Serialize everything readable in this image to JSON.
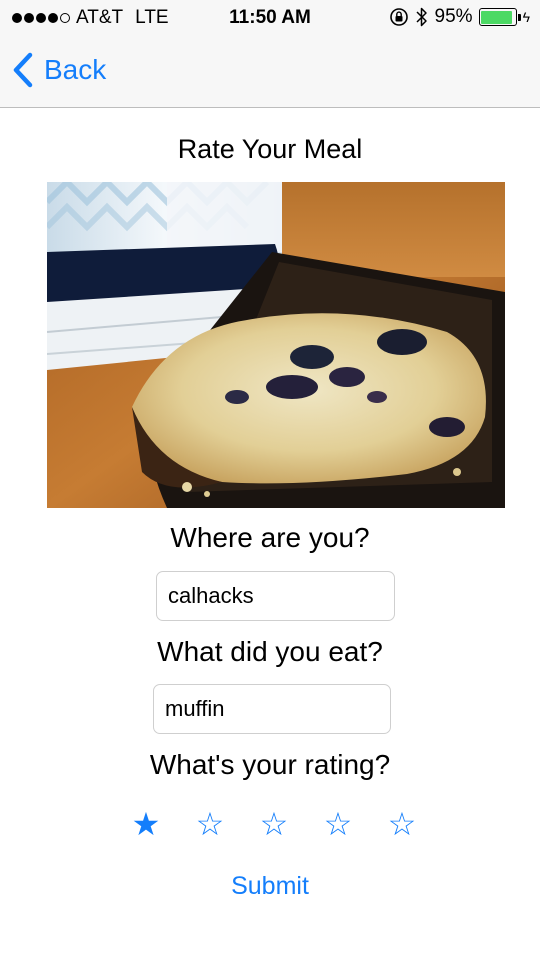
{
  "status_bar": {
    "carrier": "AT&T",
    "network": "LTE",
    "time": "11:50 AM",
    "battery_percent": "95%",
    "battery_level": 0.95,
    "battery_color": "#4cd964",
    "icons": [
      "signal-dots-icon",
      "rotation-lock-icon",
      "bluetooth-icon",
      "battery-icon",
      "charging-bolt-icon"
    ]
  },
  "nav": {
    "back_label": "Back",
    "accent_color": "#147efb"
  },
  "page": {
    "title": "Rate Your Meal"
  },
  "form": {
    "location_label": "Where are you?",
    "location_value": "calhacks",
    "food_label": "What did you eat?",
    "food_value": "muffin",
    "rating_label": "What's your rating?",
    "rating": 1,
    "max_rating": 5,
    "filled_star": "★",
    "empty_star": "☆",
    "submit_label": "Submit"
  }
}
